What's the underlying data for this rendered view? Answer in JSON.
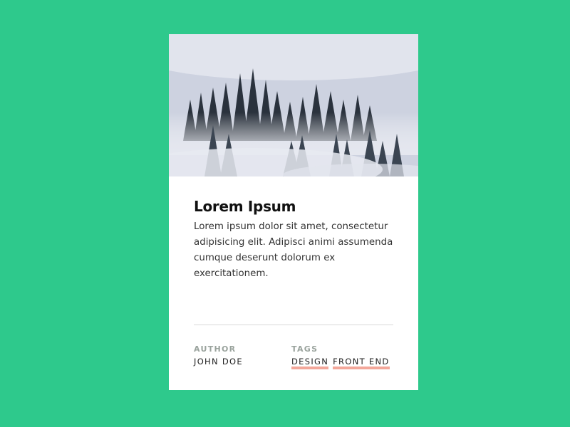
{
  "card": {
    "title": "Lorem Ipsum",
    "body": "Lorem ipsum dolor sit amet, consectetur adipisicing elit. Adipisci animi assumenda cumque deserunt dolorum ex exercitationem.",
    "author_label": "AUTHOR",
    "author_name": "JOHN DOE",
    "tags_label": "TAGS",
    "tags": [
      "DESIGN",
      "FRONT END"
    ]
  },
  "colors": {
    "background": "#2ec98c",
    "card": "#ffffff",
    "tag_underline": "#f3a79a"
  }
}
